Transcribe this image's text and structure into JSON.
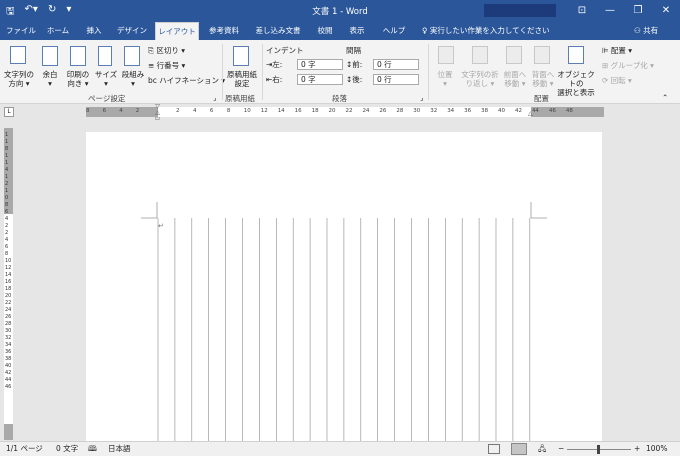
{
  "titlebar": {
    "doc_title": "文書 1  -  Word",
    "qat": {
      "save": "🖫",
      "undo": "↶▾",
      "redo": "↻",
      "more": "▾"
    },
    "win": {
      "ribbon_display": "⊡",
      "minimize": "—",
      "restore": "❐",
      "close": "✕"
    }
  },
  "tabs": [
    {
      "label": "ファイル"
    },
    {
      "label": "ホーム"
    },
    {
      "label": "挿入"
    },
    {
      "label": "デザイン"
    },
    {
      "label": "レイアウト"
    },
    {
      "label": "参考資料"
    },
    {
      "label": "差し込み文書"
    },
    {
      "label": "校閲"
    },
    {
      "label": "表示"
    },
    {
      "label": "ヘルプ"
    }
  ],
  "tellme": "実行したい作業を入力してください",
  "share": "共有",
  "ribbon": {
    "page_setup": {
      "text_dir": [
        "文字列の",
        "方向 ▾"
      ],
      "margins": [
        "余白",
        "▾"
      ],
      "orientation": [
        "印刷の",
        "向き ▾"
      ],
      "size": [
        "サイズ",
        "▾"
      ],
      "columns": [
        "段組み",
        "▾"
      ],
      "breaks": "区切り ▾",
      "line_numbers": "行番号 ▾",
      "hyphenation": "ハイフネーション ▾",
      "group_label": "ページ設定"
    },
    "genko": {
      "btn": [
        "原稿用紙",
        "設定"
      ],
      "group_label": "原稿用紙"
    },
    "paragraph": {
      "indent_label": "インデント",
      "spacing_label": "間隔",
      "left_label": "左:",
      "right_label": "右:",
      "before_label": "前:",
      "after_label": "後:",
      "left_val": "0 字",
      "right_val": "0 字",
      "before_val": "0 行",
      "after_val": "0 行",
      "group_label": "段落"
    },
    "arrange": {
      "position": [
        "位置",
        "▾"
      ],
      "wrap": [
        "文字列の折",
        "り返し ▾"
      ],
      "forward": [
        "前面へ",
        "移動 ▾"
      ],
      "backward": [
        "背面へ",
        "移動 ▾"
      ],
      "selection_pane": [
        "オブジェクトの",
        "選択と表示"
      ],
      "align": "配置 ▾",
      "group": "グループ化 ▾",
      "rotate": "回転 ▾",
      "group_label": "配置"
    }
  },
  "ruler_ticks": [
    "8",
    "6",
    "4",
    "2",
    "2",
    "4",
    "6",
    "8",
    "10",
    "12",
    "14",
    "16",
    "18",
    "20",
    "22",
    "24",
    "26",
    "28",
    "30",
    "32",
    "34",
    "36",
    "38",
    "40",
    "42",
    "44",
    "46",
    "48"
  ],
  "vruler_marks": "1 1 8 1 1 4 1 2 1 0 8 6 4 2 2 4 6 8 10 12 14 16 18 20 22 24 26 28 30 32 34 36 38 40 42 44 46",
  "status": {
    "page": "1/1 ページ",
    "words": "0 文字",
    "lang": "日本語",
    "zoom": "100%"
  },
  "colors": {
    "accent": "#2b579a",
    "ribbon_bg": "#f3f3f3",
    "canvas_bg": "#e6e6e6"
  }
}
